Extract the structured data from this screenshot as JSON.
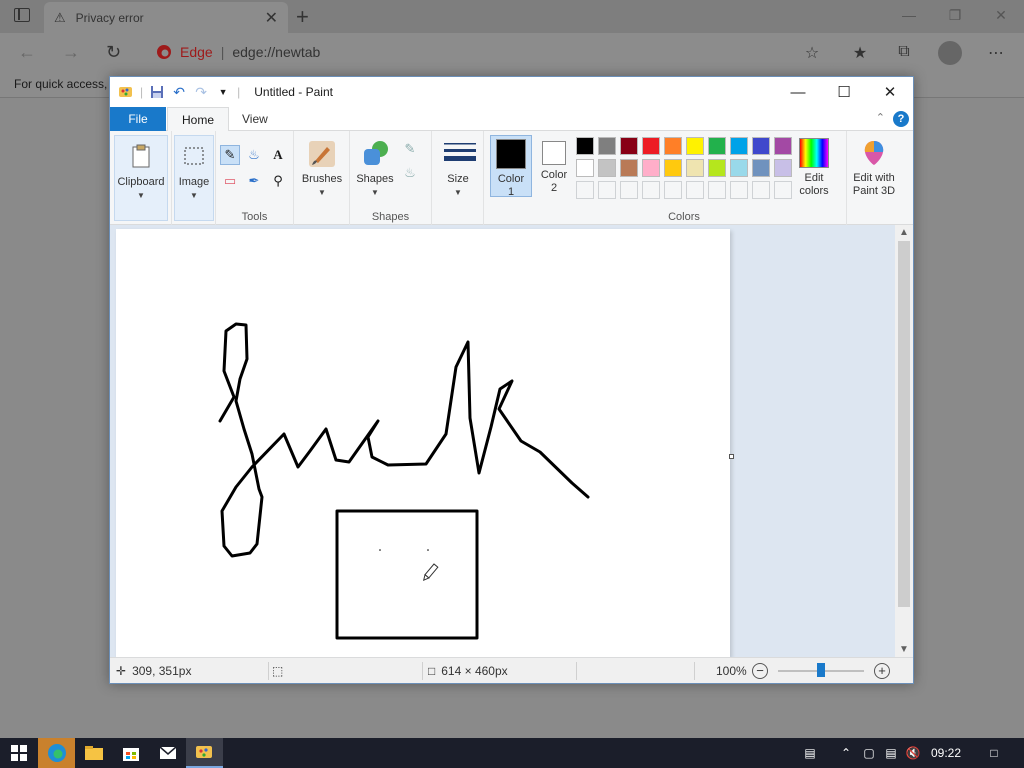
{
  "browser": {
    "tab_title": "Privacy error",
    "address_brand": "Edge",
    "address_url": "edge://newtab",
    "favorites_hint": "For quick access,"
  },
  "paint": {
    "window_title": "Untitled - Paint",
    "tabs": [
      {
        "label": "File"
      },
      {
        "label": "Home"
      },
      {
        "label": "View"
      }
    ],
    "help_label": "?",
    "groups": {
      "clipboard": "Clipboard",
      "image": "Image",
      "tools": "Tools",
      "brushes": "Brushes",
      "shapes_btn": "Shapes",
      "shapes_group": "Shapes",
      "size": "Size",
      "colors": "Colors"
    },
    "color1_label": "Color 1",
    "color1_line1": "Color",
    "color1_line2": "1",
    "color2_line1": "Color",
    "color2_line2": "2",
    "edit_colors_line1": "Edit",
    "edit_colors_line2": "colors",
    "edit3d_line1": "Edit with",
    "edit3d_line2": "Paint 3D",
    "color1_value": "#000000",
    "color2_value": "#ffffff",
    "palette": [
      "#000000",
      "#7f7f7f",
      "#880015",
      "#ed1c24",
      "#ff7f27",
      "#fff200",
      "#22b14c",
      "#00a2e8",
      "#3f48cc",
      "#a349a4",
      "#ffffff",
      "#c3c3c3",
      "#b97a57",
      "#ffaec9",
      "#ffc90e",
      "#efe4b0",
      "#b5e61d",
      "#99d9ea",
      "#7092be",
      "#c8bfe7"
    ],
    "status": {
      "cursor_pos": "309, 351px",
      "canvas_size": "614 × 460px",
      "zoom": "100%"
    }
  },
  "taskbar": {
    "time": "09:22"
  }
}
